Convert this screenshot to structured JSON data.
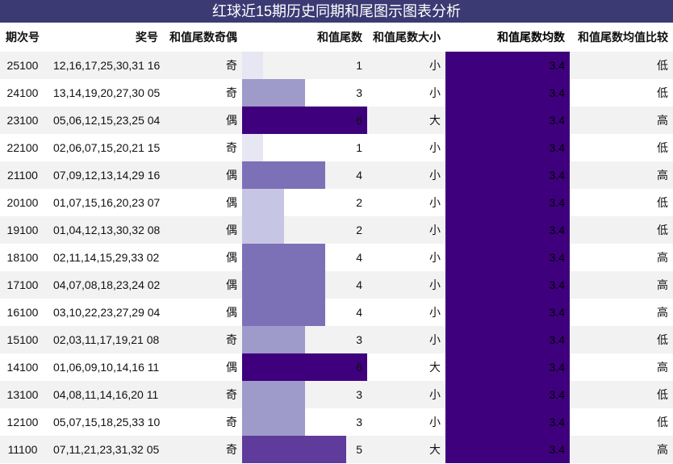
{
  "title": "红球近15期历史同期和尾图示图表分析",
  "headers": {
    "issue": "期次号",
    "prize": "奖号",
    "parity": "和值尾数奇偶",
    "tail": "和值尾数",
    "size": "和值尾数大小",
    "avg": "和值尾数均数",
    "cmp": "和值尾数均值比较"
  },
  "colors": {
    "header_bar": "#3b3a73",
    "avg_fill": "#3f007d",
    "tail_scale": {
      "1": "#e7e6f3",
      "2": "#c6c5e3",
      "3": "#9e9aca",
      "4": "#7c71b6",
      "5": "#5f3b9c",
      "6": "#3f007d"
    }
  },
  "max_tail": 6,
  "rows": [
    {
      "issue": "25100",
      "prize": "12,16,17,25,30,31 16",
      "parity": "奇",
      "tail": 1,
      "size": "小",
      "avg": "3.4",
      "cmp": "低"
    },
    {
      "issue": "24100",
      "prize": "13,14,19,20,27,30 05",
      "parity": "奇",
      "tail": 3,
      "size": "小",
      "avg": "3.4",
      "cmp": "低"
    },
    {
      "issue": "23100",
      "prize": "05,06,12,15,23,25 04",
      "parity": "偶",
      "tail": 6,
      "size": "大",
      "avg": "3.4",
      "cmp": "高"
    },
    {
      "issue": "22100",
      "prize": "02,06,07,15,20,21 15",
      "parity": "奇",
      "tail": 1,
      "size": "小",
      "avg": "3.4",
      "cmp": "低"
    },
    {
      "issue": "21100",
      "prize": "07,09,12,13,14,29 16",
      "parity": "偶",
      "tail": 4,
      "size": "小",
      "avg": "3.4",
      "cmp": "高"
    },
    {
      "issue": "20100",
      "prize": "01,07,15,16,20,23 07",
      "parity": "偶",
      "tail": 2,
      "size": "小",
      "avg": "3.4",
      "cmp": "低"
    },
    {
      "issue": "19100",
      "prize": "01,04,12,13,30,32 08",
      "parity": "偶",
      "tail": 2,
      "size": "小",
      "avg": "3.4",
      "cmp": "低"
    },
    {
      "issue": "18100",
      "prize": "02,11,14,15,29,33 02",
      "parity": "偶",
      "tail": 4,
      "size": "小",
      "avg": "3.4",
      "cmp": "高"
    },
    {
      "issue": "17100",
      "prize": "04,07,08,18,23,24 02",
      "parity": "偶",
      "tail": 4,
      "size": "小",
      "avg": "3.4",
      "cmp": "高"
    },
    {
      "issue": "16100",
      "prize": "03,10,22,23,27,29 04",
      "parity": "偶",
      "tail": 4,
      "size": "小",
      "avg": "3.4",
      "cmp": "高"
    },
    {
      "issue": "15100",
      "prize": "02,03,11,17,19,21 08",
      "parity": "奇",
      "tail": 3,
      "size": "小",
      "avg": "3.4",
      "cmp": "低"
    },
    {
      "issue": "14100",
      "prize": "01,06,09,10,14,16 11",
      "parity": "偶",
      "tail": 6,
      "size": "大",
      "avg": "3.4",
      "cmp": "高"
    },
    {
      "issue": "13100",
      "prize": "04,08,11,14,16,20 11",
      "parity": "奇",
      "tail": 3,
      "size": "小",
      "avg": "3.4",
      "cmp": "低"
    },
    {
      "issue": "12100",
      "prize": "05,07,15,18,25,33 10",
      "parity": "奇",
      "tail": 3,
      "size": "小",
      "avg": "3.4",
      "cmp": "低"
    },
    {
      "issue": "11100",
      "prize": "07,11,21,23,31,32 05",
      "parity": "奇",
      "tail": 5,
      "size": "大",
      "avg": "3.4",
      "cmp": "高"
    }
  ]
}
